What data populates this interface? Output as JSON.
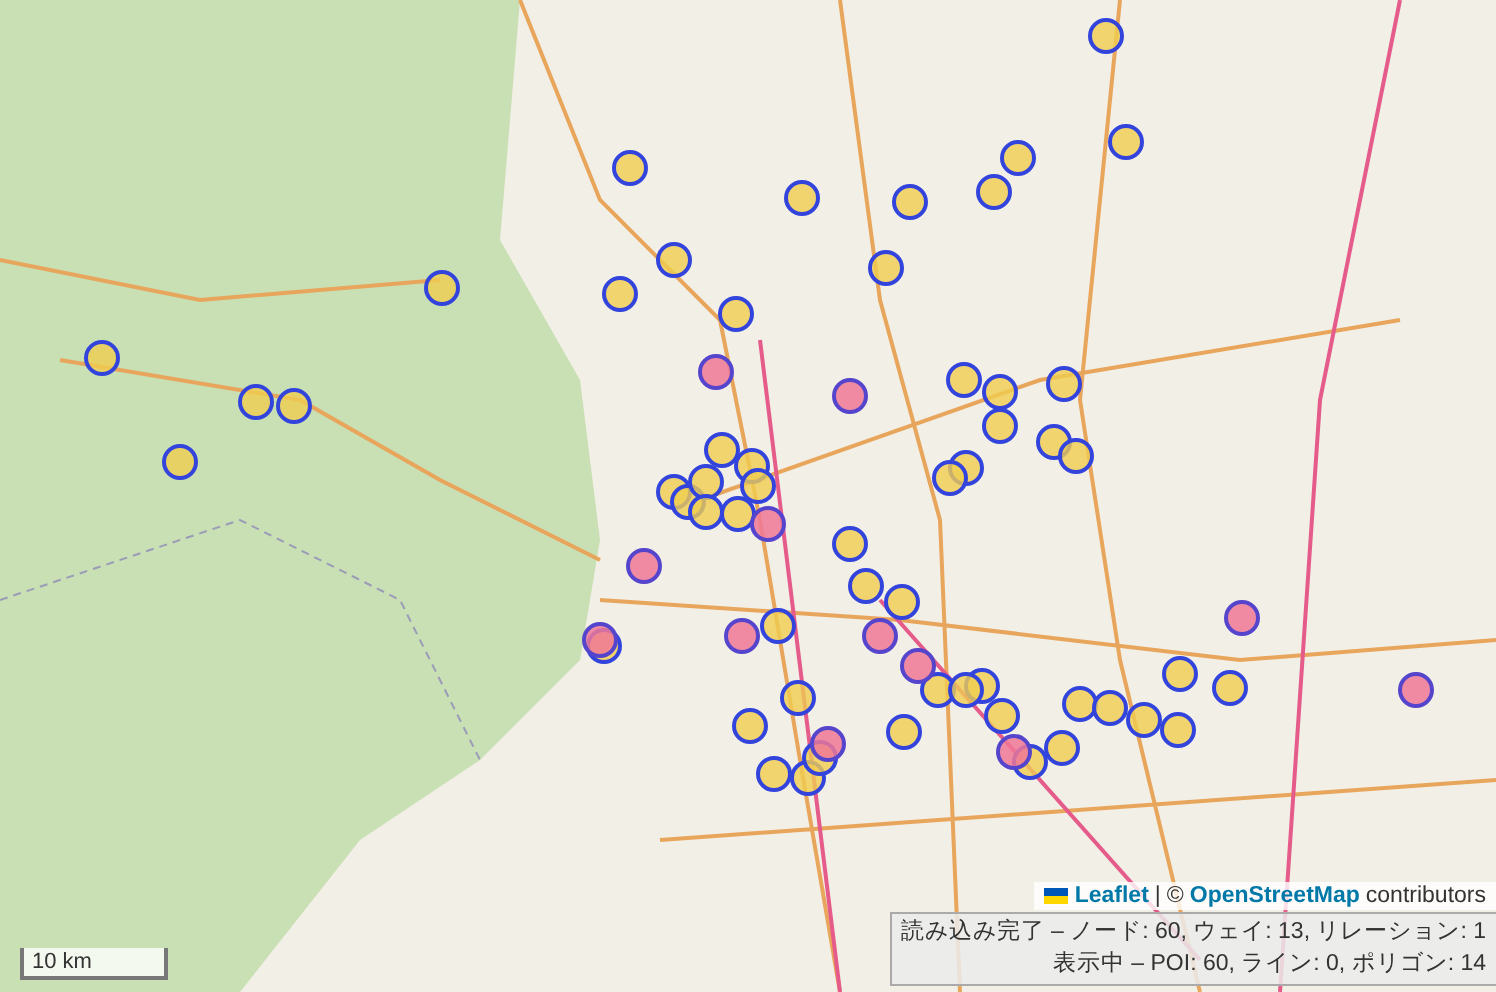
{
  "map": {
    "scale": "10 km",
    "attribution": {
      "library": "Leaflet",
      "separator": "|",
      "copyright": "©",
      "link": "OpenStreetMap",
      "suffix": "contributors"
    }
  },
  "status": [
    "読み込み完了 – ノード: 60, ウェイ: 13, リレーション: 1",
    "表示中 – POI: 60, ライン: 0, ポリゴン: 14"
  ]
}
